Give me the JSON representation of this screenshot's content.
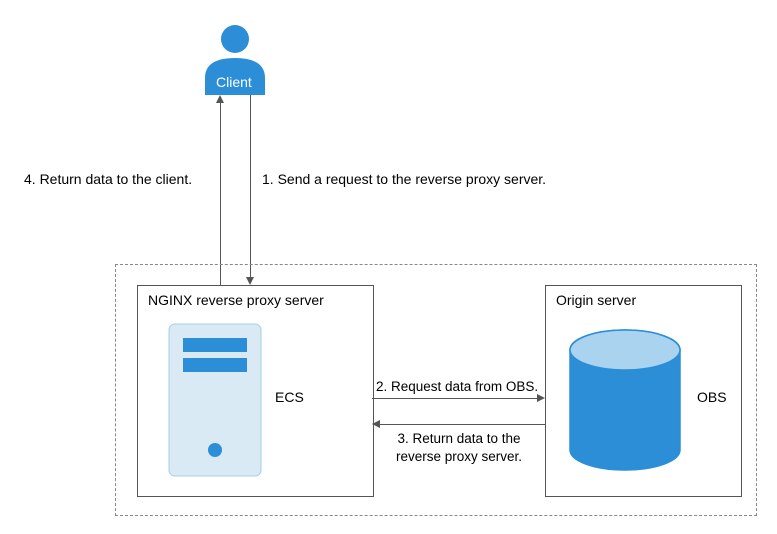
{
  "client": {
    "label": "Client"
  },
  "steps": {
    "s1": "1. Send a request to the reverse proxy server.",
    "s2": "2. Request data from OBS.",
    "s3": "3. Return data to the\nreverse proxy server.",
    "s4": "4. Return data to the client."
  },
  "proxy": {
    "title": "NGINX reverse proxy server",
    "label": "ECS"
  },
  "origin": {
    "title": "Origin server",
    "label": "OBS"
  }
}
